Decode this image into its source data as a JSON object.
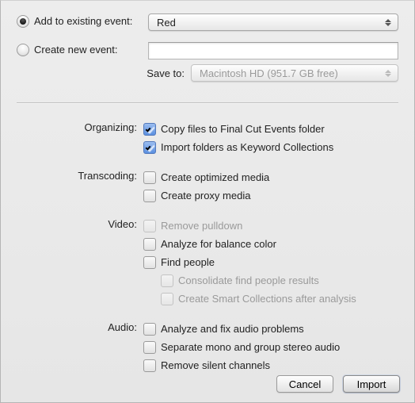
{
  "event": {
    "addLabel": "Add to existing event:",
    "createLabel": "Create new event:",
    "existingValue": "Red",
    "newValue": "",
    "saveToLabel": "Save to:",
    "saveToValue": "Macintosh HD   (951.7 GB free)"
  },
  "sections": {
    "organizing": {
      "label": "Organizing:",
      "copy": "Copy files to Final Cut Events folder",
      "importFolders": "Import folders as Keyword Collections"
    },
    "transcoding": {
      "label": "Transcoding:",
      "optimized": "Create optimized media",
      "proxy": "Create proxy media"
    },
    "video": {
      "label": "Video:",
      "pulldown": "Remove pulldown",
      "balance": "Analyze for balance color",
      "find": "Find people",
      "consolidate": "Consolidate find people results",
      "smart": "Create Smart Collections after analysis"
    },
    "audio": {
      "label": "Audio:",
      "analyze": "Analyze and fix audio problems",
      "separate": "Separate mono and group stereo audio",
      "remove": "Remove silent channels"
    }
  },
  "buttons": {
    "cancel": "Cancel",
    "import": "Import"
  }
}
